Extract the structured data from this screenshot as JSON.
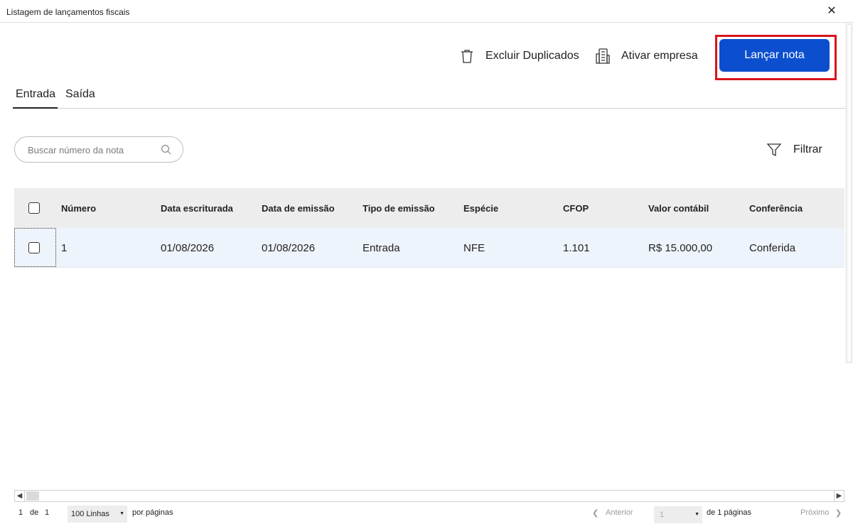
{
  "window": {
    "title": "Listagem de lançamentos fiscais",
    "close_icon": "close-icon"
  },
  "toolbar": {
    "delete_duplicates_label": "Excluir Duplicados",
    "activate_company_label": "Ativar empresa",
    "launch_note_label": "Lançar nota",
    "primary_color": "#0b4fcf",
    "highlight_color": "#d7141a"
  },
  "tabs": [
    {
      "label": "Entrada",
      "active": true
    },
    {
      "label": "Saída",
      "active": false
    }
  ],
  "search": {
    "placeholder": "Buscar número da nota",
    "value": ""
  },
  "filter": {
    "label": "Filtrar"
  },
  "table": {
    "columns": [
      "Número",
      "Data escriturada",
      "Data de emissão",
      "Tipo de emissão",
      "Espécie",
      "CFOP",
      "Valor contábil",
      "Conferência"
    ],
    "rows": [
      [
        "1",
        "01/08/2026",
        "01/08/2026",
        "Entrada",
        "NFE",
        "1.101",
        "R$ 15.000,00",
        "Conferida"
      ]
    ]
  },
  "pagination": {
    "current": "1",
    "of_label": "de",
    "total": "1",
    "rows_option": "100 Linhas",
    "per_page_label": "por páginas",
    "previous_label": "Anterior",
    "page_value": "1",
    "pages_label": "de 1 páginas",
    "next_label": "Próximo"
  }
}
